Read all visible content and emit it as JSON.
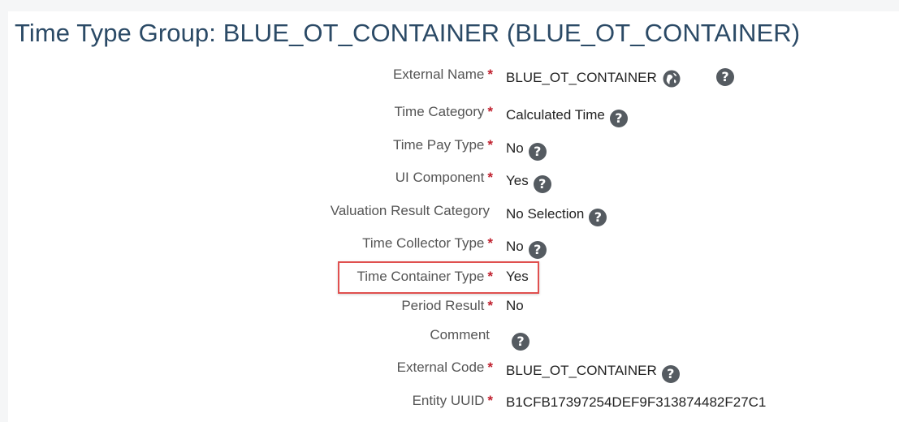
{
  "page": {
    "title": "Time Type Group: BLUE_OT_CONTAINER (BLUE_OT_CONTAINER)"
  },
  "fields": [
    {
      "label": "External Name",
      "required": "*",
      "value": "BLUE_OT_CONTAINER"
    },
    {
      "label": "Time Category",
      "required": "*",
      "value": "Calculated Time"
    },
    {
      "label": "Time Pay Type",
      "required": "*",
      "value": "No"
    },
    {
      "label": "UI Component",
      "required": "*",
      "value": "Yes"
    },
    {
      "label": "Valuation Result Category",
      "required": "",
      "value": "No Selection"
    },
    {
      "label": "Time Collector Type",
      "required": "*",
      "value": "No"
    },
    {
      "label": "Time Container Type",
      "required": "*",
      "value": "Yes"
    },
    {
      "label": "Period Result",
      "required": "*",
      "value": "No"
    },
    {
      "label": "Comment",
      "required": "",
      "value": ""
    },
    {
      "label": "External Code",
      "required": "*",
      "value": "BLUE_OT_CONTAINER"
    },
    {
      "label": "Entity UUID",
      "required": "*",
      "value": "B1CFB17397254DEF9F313874482F27C1"
    }
  ],
  "icons": {
    "help_glyph": "?",
    "help_icon": "help-circle-icon",
    "translate_icon": "globe-icon"
  },
  "colors": {
    "title": "#2b4a66",
    "required_asterisk": "#c0202e",
    "highlight_border": "#e0504f",
    "help_icon_bg": "#555b61"
  }
}
